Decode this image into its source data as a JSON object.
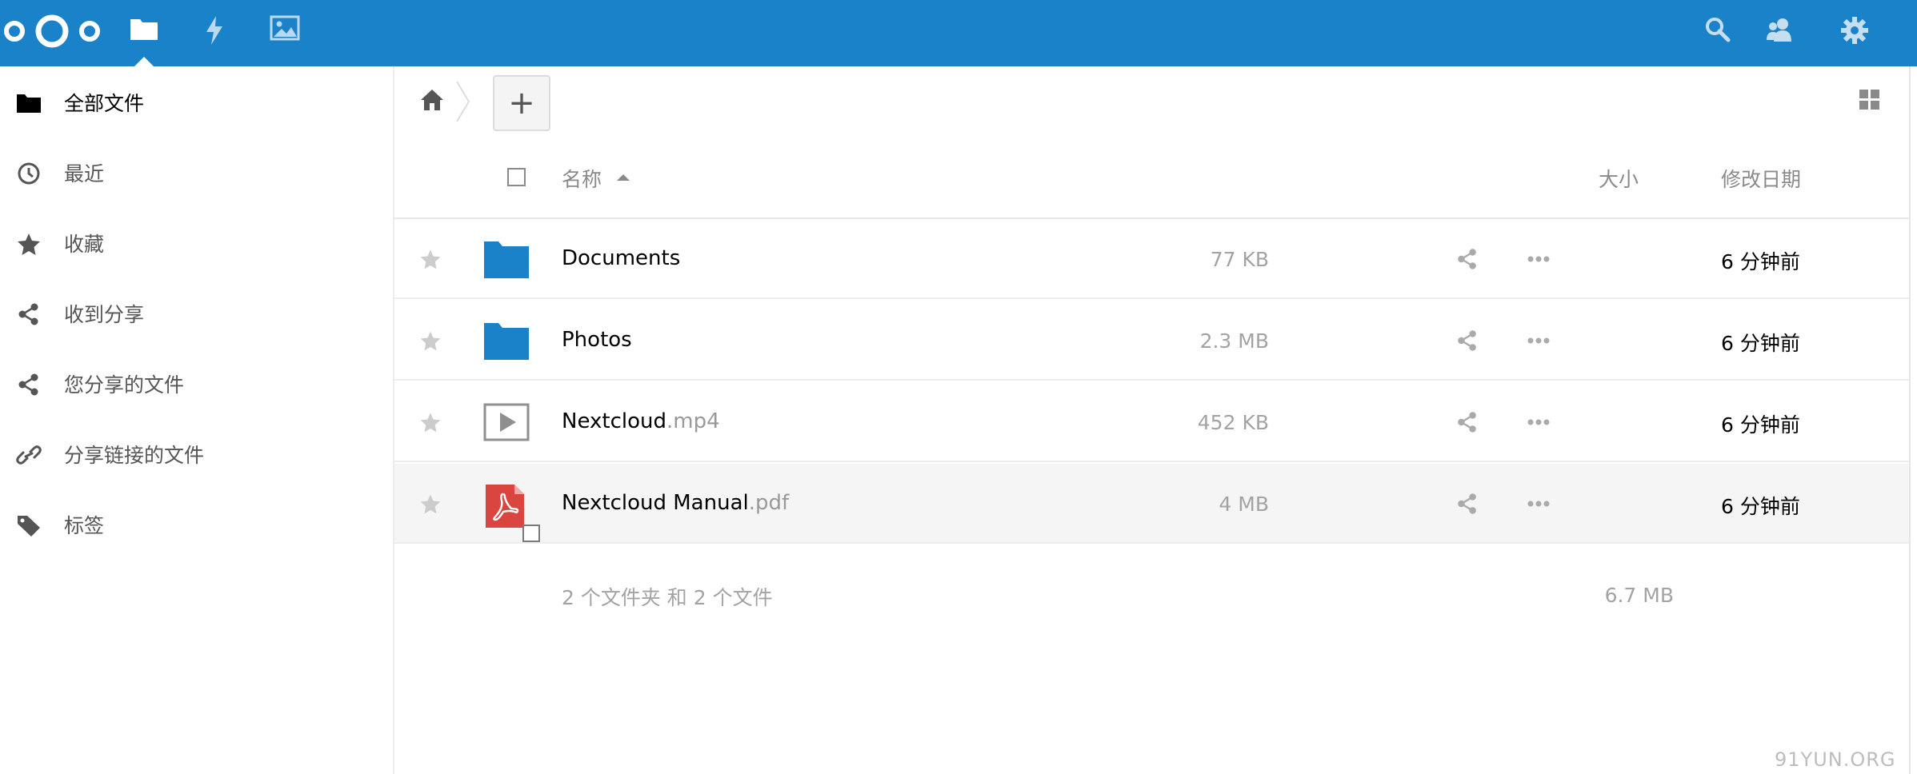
{
  "header": {
    "apps": [
      {
        "icon": "folder-icon",
        "name": "files"
      },
      {
        "icon": "lightning-icon",
        "name": "activity"
      },
      {
        "icon": "image-icon",
        "name": "gallery"
      }
    ],
    "right_icons": [
      "search-icon",
      "contacts-icon",
      "gear-icon"
    ],
    "colors": {
      "topbar": "#1a82c9"
    }
  },
  "sidebar": {
    "items": [
      {
        "label": "全部文件",
        "icon": "folder-icon",
        "active": true
      },
      {
        "label": "最近",
        "icon": "clock-icon"
      },
      {
        "label": "收藏",
        "icon": "star-icon"
      },
      {
        "label": "收到分享",
        "icon": "share-icon"
      },
      {
        "label": "您分享的文件",
        "icon": "share-icon"
      },
      {
        "label": "分享链接的文件",
        "icon": "link-icon"
      },
      {
        "label": "标签",
        "icon": "tag-icon"
      }
    ]
  },
  "toolbar": {
    "new_label": "+"
  },
  "table": {
    "headers": {
      "name": "名称",
      "size": "大小",
      "modified": "修改日期"
    },
    "rows": [
      {
        "base": "Documents",
        "ext": "",
        "size": "77 KB",
        "modified": "6 分钟前",
        "icon": "folder-icon"
      },
      {
        "base": "Photos",
        "ext": "",
        "size": "2.3 MB",
        "modified": "6 分钟前",
        "icon": "folder-icon"
      },
      {
        "base": "Nextcloud",
        "ext": ".mp4",
        "size": "452 KB",
        "modified": "6 分钟前",
        "icon": "video-icon"
      },
      {
        "base": "Nextcloud Manual",
        "ext": ".pdf",
        "size": "4 MB",
        "modified": "6 分钟前",
        "icon": "pdf-icon"
      }
    ],
    "summary": {
      "text": "2 个文件夹 和 2 个文件",
      "size": "6.7 MB"
    }
  },
  "watermark": "91YUN.ORG"
}
